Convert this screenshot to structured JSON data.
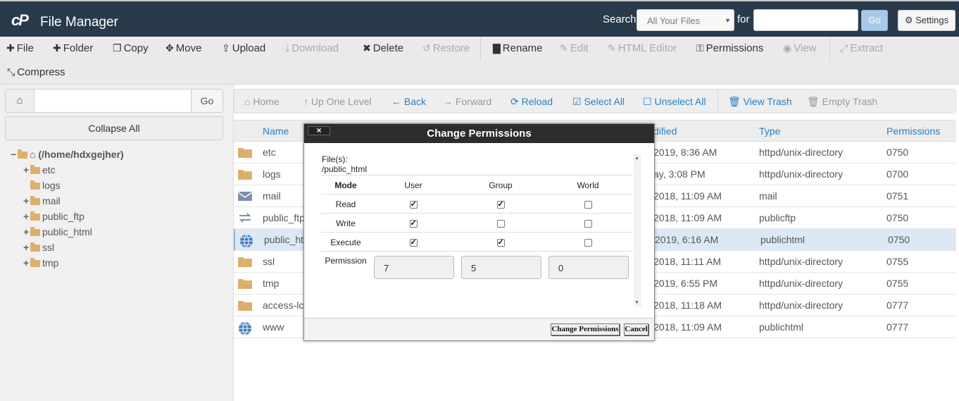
{
  "header": {
    "logo": "cP",
    "title": "File Manager",
    "search_label": "Search",
    "search_scope": "All Your Files",
    "for_label": "for",
    "search_value": "",
    "go_label": "Go",
    "settings_label": "Settings"
  },
  "toolbar": {
    "file": "File",
    "folder": "Folder",
    "copy": "Copy",
    "move": "Move",
    "upload": "Upload",
    "download": "Download",
    "delete": "Delete",
    "restore": "Restore",
    "rename": "Rename",
    "edit": "Edit",
    "html_editor": "HTML Editor",
    "permissions": "Permissions",
    "view": "View",
    "extract": "Extract",
    "compress": "Compress"
  },
  "left": {
    "path_value": "",
    "go_label": "Go",
    "collapse_label": "Collapse All",
    "tree_root": "(/home/hdxgejher)",
    "tree": [
      "etc",
      "logs",
      "mail",
      "public_ftp",
      "public_html",
      "ssl",
      "tmp"
    ]
  },
  "nav": {
    "home": "Home",
    "up": "Up One Level",
    "back": "Back",
    "forward": "Forward",
    "reload": "Reload",
    "select_all": "Select All",
    "unselect_all": "Unselect All",
    "view_trash": "View Trash",
    "empty_trash": "Empty Trash"
  },
  "table": {
    "headers": {
      "name": "Name",
      "modified": "dified",
      "type": "Type",
      "permissions": "Permissions"
    },
    "rows": [
      {
        "name": "etc",
        "modified": "2019, 8:36 AM",
        "type": "httpd/unix-directory",
        "perm": "0750",
        "icon": "folder-icon"
      },
      {
        "name": "logs",
        "modified": "ay, 3:08 PM",
        "type": "httpd/unix-directory",
        "perm": "0700",
        "icon": "folder-icon"
      },
      {
        "name": "mail",
        "modified": "2018, 11:09 AM",
        "type": "mail",
        "perm": "0751",
        "icon": "mail-icon"
      },
      {
        "name": "public_ftp",
        "modified": "2018, 11:09 AM",
        "type": "publicftp",
        "perm": "0750",
        "icon": "transfer-icon"
      },
      {
        "name": "public_ht",
        "modified": "2019, 6:16 AM",
        "type": "publichtml",
        "perm": "0750",
        "icon": "globe-icon"
      },
      {
        "name": "ssl",
        "modified": "2018, 11:11 AM",
        "type": "httpd/unix-directory",
        "perm": "0755",
        "icon": "folder-icon"
      },
      {
        "name": "tmp",
        "modified": "2019, 6:55 PM",
        "type": "httpd/unix-directory",
        "perm": "0755",
        "icon": "folder-icon"
      },
      {
        "name": "access-lc",
        "modified": "2018, 11:18 AM",
        "type": "httpd/unix-directory",
        "perm": "0777",
        "icon": "folder-icon"
      },
      {
        "name": "www",
        "modified": "2018, 11:09 AM",
        "type": "publichtml",
        "perm": "0777",
        "icon": "globe-icon"
      }
    ]
  },
  "dialog": {
    "title": "Change Permissions",
    "close": "×",
    "files_label": "File(s):",
    "file_path": "/public_html",
    "headers": {
      "mode": "Mode",
      "user": "User",
      "group": "Group",
      "world": "World"
    },
    "rows": [
      {
        "label": "Read",
        "user": true,
        "group": true,
        "world": false
      },
      {
        "label": "Write",
        "user": true,
        "group": false,
        "world": false
      },
      {
        "label": "Execute",
        "user": true,
        "group": true,
        "world": false
      }
    ],
    "permission_label": "Permission",
    "values": {
      "user": "7",
      "group": "5",
      "world": "0"
    },
    "submit": "Change Permissions",
    "cancel": "Cancel"
  },
  "colors": {
    "header_bg": "#293a4a",
    "link": "#2a80c0",
    "folder": "#dcb06a",
    "selected_row": "#dce9f5"
  }
}
